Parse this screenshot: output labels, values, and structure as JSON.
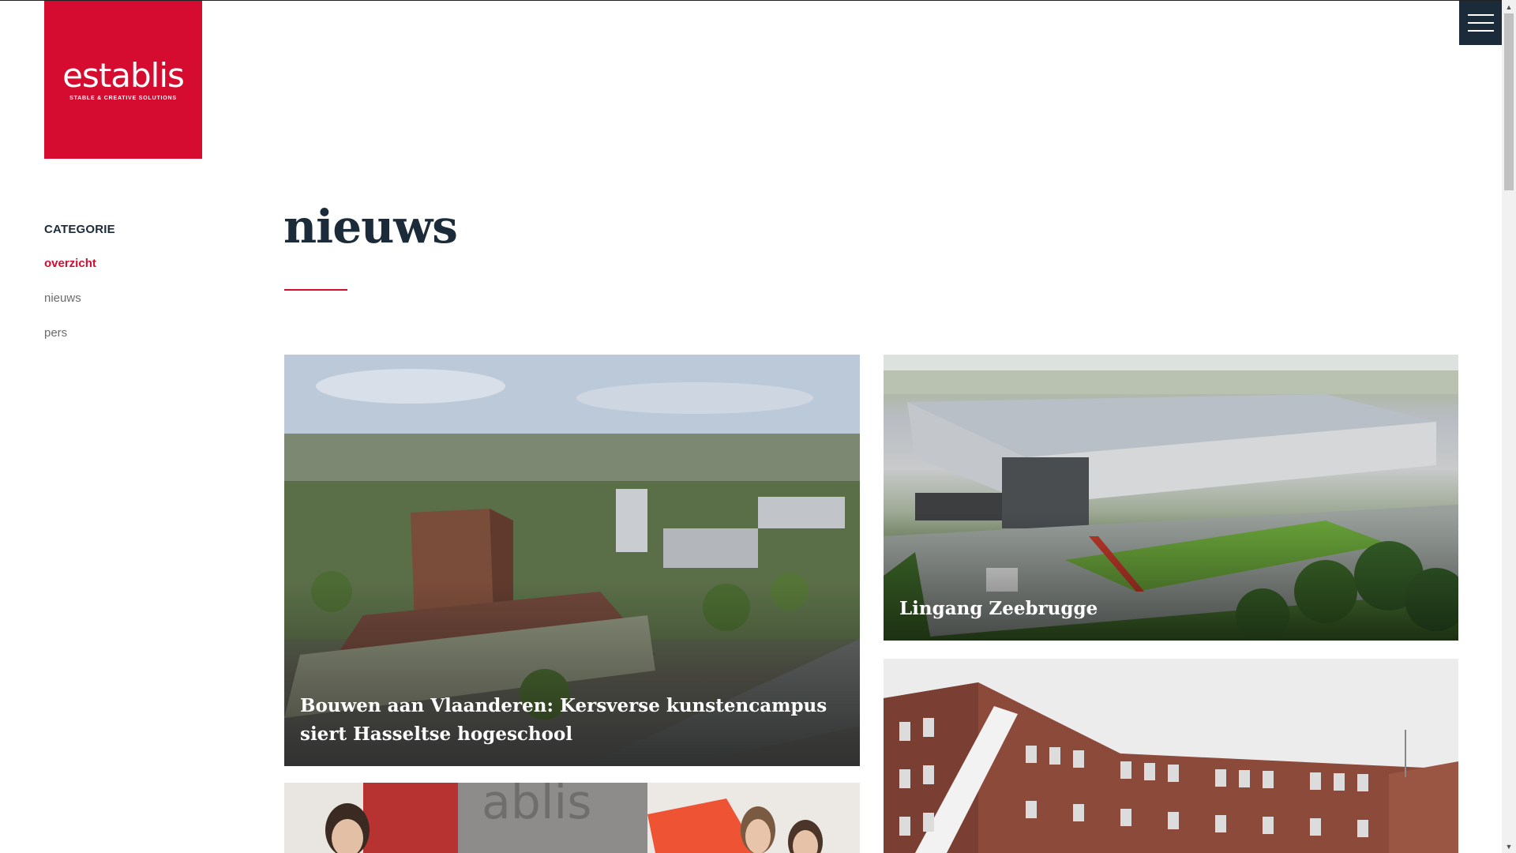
{
  "brand": {
    "name": "establis",
    "tagline": "STABLE & CREATIVE SOLUTIONS",
    "color": "#d50c2f"
  },
  "header": {
    "menu_icon": "hamburger-menu-icon"
  },
  "sidebar": {
    "heading": "CATEGORIE",
    "items": [
      {
        "label": "overzicht",
        "active": true
      },
      {
        "label": "nieuws",
        "active": false
      },
      {
        "label": "pers",
        "active": false
      }
    ]
  },
  "main": {
    "title": "nieuws",
    "cards": [
      {
        "caption": "Bouwen aan Vlaanderen: Kersverse kunstencampus siert Hasseltse hogeschool"
      },
      {
        "caption": "Lingang Zeebrugge"
      },
      {
        "caption": ""
      },
      {
        "caption": ""
      }
    ]
  },
  "colors": {
    "accent": "#d50c2f",
    "navy": "#1c2b39",
    "muted": "#6b6b6b"
  }
}
